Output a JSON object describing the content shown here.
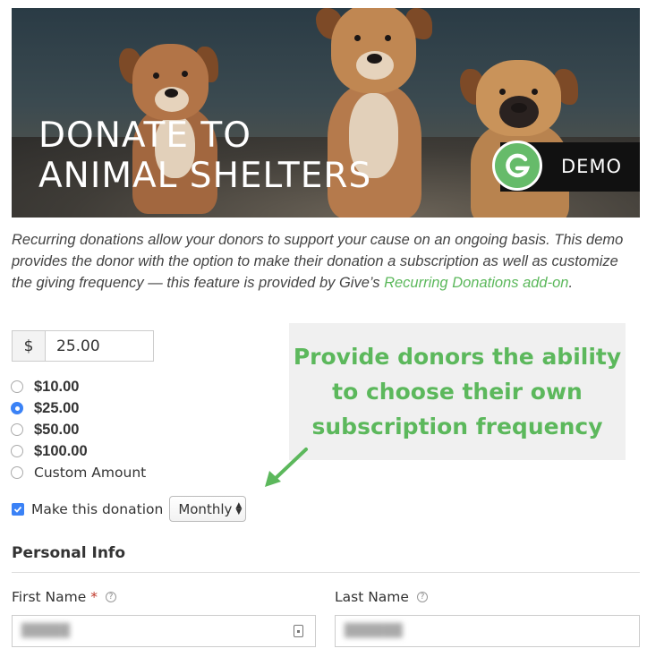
{
  "banner": {
    "title_line1": "DONATE TO",
    "title_line2": "ANIMAL SHELTERS",
    "badge": "DEMO"
  },
  "description": {
    "text": "Recurring donations allow your donors to support your cause on an ongoing basis. This demo provides the donor with the option to make their donation a subscription as well as customize the giving frequency — this feature is provided by Give’s ",
    "link": "Recurring Donations add-on",
    "suffix": "."
  },
  "amount": {
    "currency": "$",
    "value": "25.00"
  },
  "levels": [
    {
      "label": "$10.00",
      "selected": false
    },
    {
      "label": "$25.00",
      "selected": true
    },
    {
      "label": "$50.00",
      "selected": false
    },
    {
      "label": "$100.00",
      "selected": false
    },
    {
      "label": "Custom Amount",
      "selected": false
    }
  ],
  "recurring": {
    "label": "Make this donation",
    "checked": true,
    "frequency": "Monthly"
  },
  "callout": {
    "line1": "Provide donors the ability",
    "line2": "to choose their own",
    "line3": "subscription frequency"
  },
  "personal_info": {
    "title": "Personal Info",
    "first_name_label": "First Name",
    "required_mark": "*",
    "last_name_label": "Last Name",
    "help_glyph": "?"
  },
  "colors": {
    "accent_green": "#5cb85c",
    "radio_blue": "#3b82f6"
  }
}
